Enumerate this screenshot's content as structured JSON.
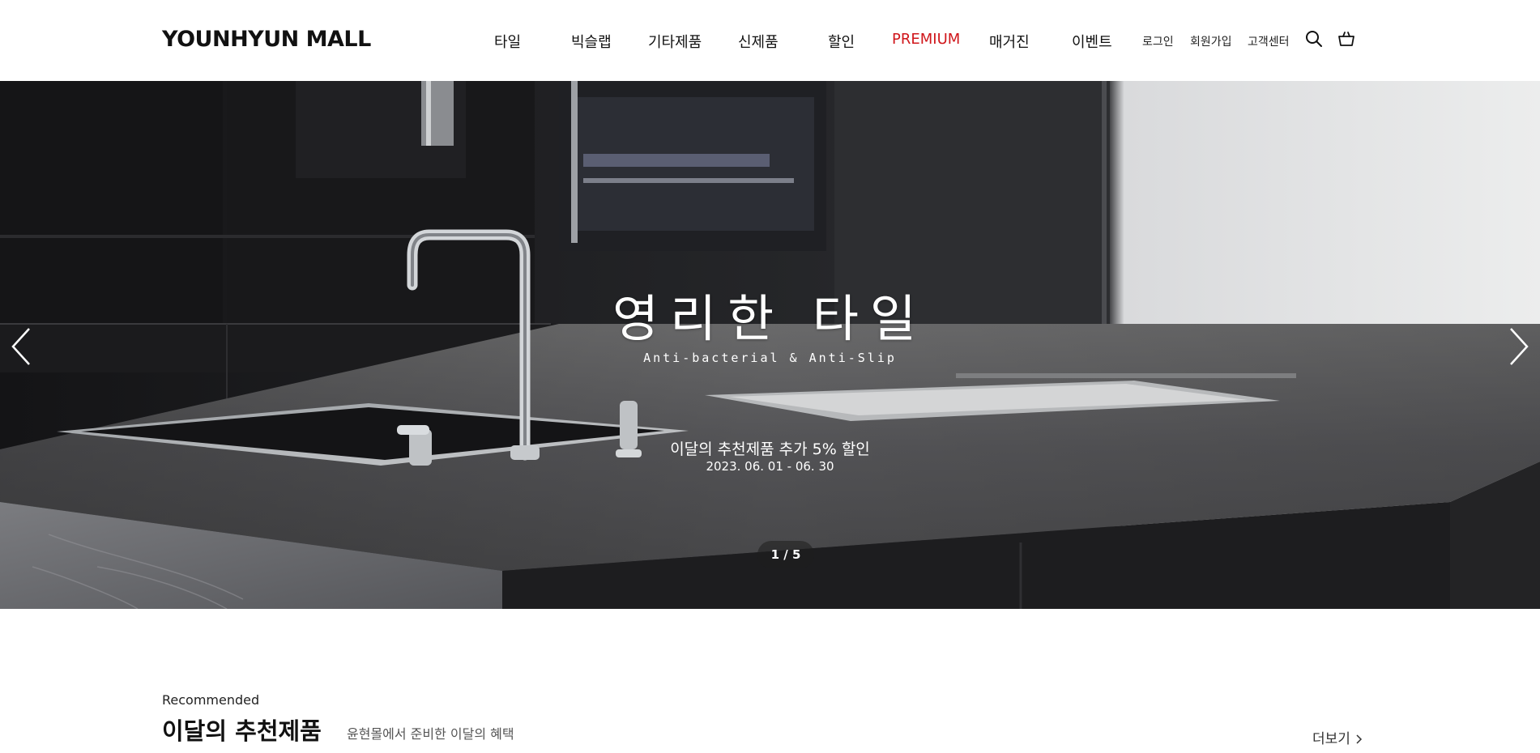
{
  "header": {
    "logo": "YOUNHYUN MALL",
    "nav": [
      "타일",
      "빅슬랩",
      "기타제품",
      "신제품",
      "할인",
      "PREMIUM",
      "매거진",
      "이벤트"
    ],
    "utility": [
      "로그인",
      "회원가입",
      "고객센터"
    ],
    "icons": [
      "search-icon",
      "cart-icon"
    ],
    "premium_color": "#d0161b"
  },
  "hero": {
    "title": "영리한 타일",
    "subtitle": "Anti-bacterial & Anti-Slip",
    "promo": "이달의 추천제품 추가 5% 할인",
    "date": "2023. 06. 01 - 06. 30",
    "pager": "1 / 5",
    "icons": [
      "chevron-left-icon",
      "chevron-right-icon"
    ]
  },
  "recommended": {
    "eyebrow": "Recommended",
    "title": "이달의 추천제품",
    "description": "윤현몰에서 준비한 이달의 혜택",
    "more": "더보기"
  }
}
